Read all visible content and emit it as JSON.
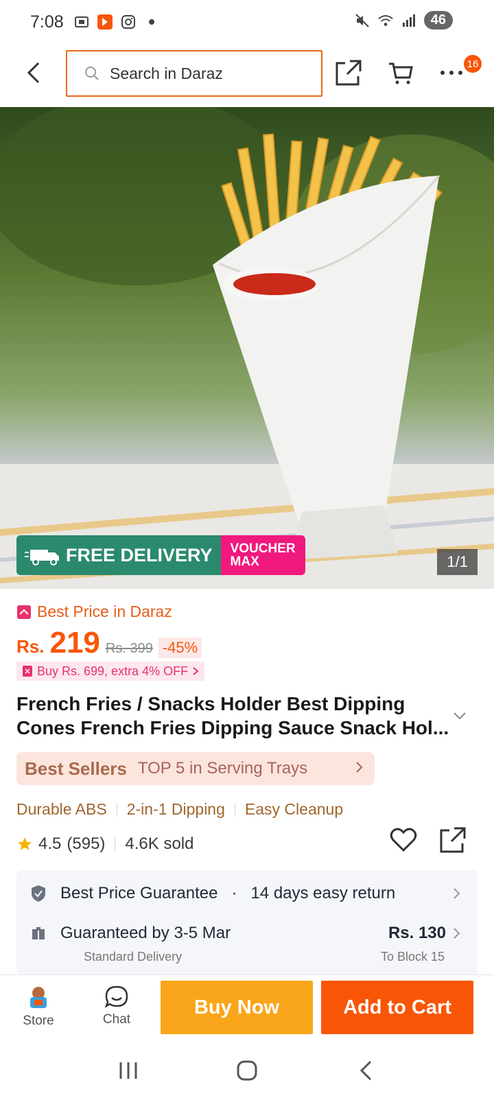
{
  "status_bar": {
    "time": "7:08",
    "battery": "46"
  },
  "header": {
    "search_placeholder": "Search in Daraz",
    "cart_badge": "16"
  },
  "image": {
    "counter": "1/1",
    "free_delivery_label": "FREE DELIVERY",
    "free_tag": "FREE",
    "voucher_line1": "VOUCHER",
    "voucher_line2": "MAX"
  },
  "pricing": {
    "best_price_label": "Best Price in Daraz",
    "currency": "Rs.",
    "price": "219",
    "old_price": "Rs. 399",
    "discount": "-45%",
    "promo": "Buy Rs. 699, extra 4% OFF"
  },
  "product": {
    "title": "French Fries / Snacks Holder Best Dipping Cones French Fries Dipping Sauce Snack Hol..."
  },
  "bestsellers": {
    "title": "Best Sellers",
    "text": "TOP 5 in Serving Trays"
  },
  "features": [
    "Durable ABS",
    "2-in-1 Dipping",
    "Easy Cleanup"
  ],
  "rating": {
    "score": "4.5",
    "count": "(595)",
    "sold": "4.6K sold"
  },
  "services": {
    "guarantee": "Best Price Guarantee",
    "return": "14 days easy return",
    "delivery": "Guaranteed by 3-5 Mar",
    "delivery_fee": "Rs. 130",
    "delivery_sub": "Standard Delivery",
    "delivery_to": "To Block 15"
  },
  "bottom_bar": {
    "store_label": "Store",
    "chat_label": "Chat",
    "buy_now": "Buy Now",
    "add_to_cart": "Add to Cart"
  },
  "colors": {
    "accent": "#f85606",
    "buy_now": "#faa61a",
    "free_delivery": "#2b8a6e",
    "voucher": "#f0197d"
  }
}
